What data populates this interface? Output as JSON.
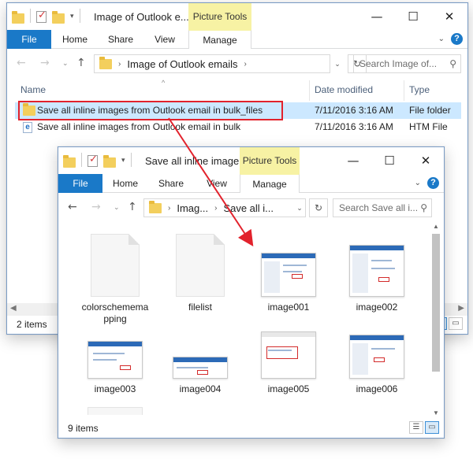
{
  "back_window": {
    "title": "Image of Outlook e...",
    "context_tab": "Picture Tools",
    "ribbon_tabs": [
      "File",
      "Home",
      "Share",
      "View",
      "Manage"
    ],
    "address_crumb": "Image of Outlook emails",
    "search_placeholder": "Search Image of...",
    "columns": {
      "name": "Name",
      "date": "Date modified",
      "type": "Type"
    },
    "rows": [
      {
        "name": "Save all inline images from Outlook email in bulk_files",
        "date": "7/11/2016 3:16 AM",
        "type": "File folder",
        "icon": "folder-icon",
        "selected": true
      },
      {
        "name": "Save all inline images from Outlook email in bulk",
        "date": "7/11/2016 3:16 AM",
        "type": "HTM File",
        "icon": "htm-file-icon",
        "selected": false
      }
    ],
    "status": "2 items"
  },
  "front_window": {
    "title": "Save all inline image...",
    "context_tab": "Picture Tools",
    "ribbon_tabs": [
      "File",
      "Home",
      "Share",
      "View",
      "Manage"
    ],
    "address_crumbs": [
      "Imag...",
      "Save all i..."
    ],
    "search_placeholder": "Search Save all i...",
    "files": [
      {
        "label": "colorschememapping",
        "kind": "document"
      },
      {
        "label": "filelist",
        "kind": "document"
      },
      {
        "label": "image001",
        "kind": "image"
      },
      {
        "label": "image002",
        "kind": "image"
      },
      {
        "label": "image003",
        "kind": "image"
      },
      {
        "label": "image004",
        "kind": "image"
      },
      {
        "label": "image005",
        "kind": "image"
      },
      {
        "label": "image006",
        "kind": "image"
      }
    ],
    "status": "9 items"
  },
  "colors": {
    "highlight_red": "#e2222c",
    "selection": "#cce8ff",
    "file_tab": "#1a79c8",
    "picture_tools": "#f7f2a4"
  }
}
